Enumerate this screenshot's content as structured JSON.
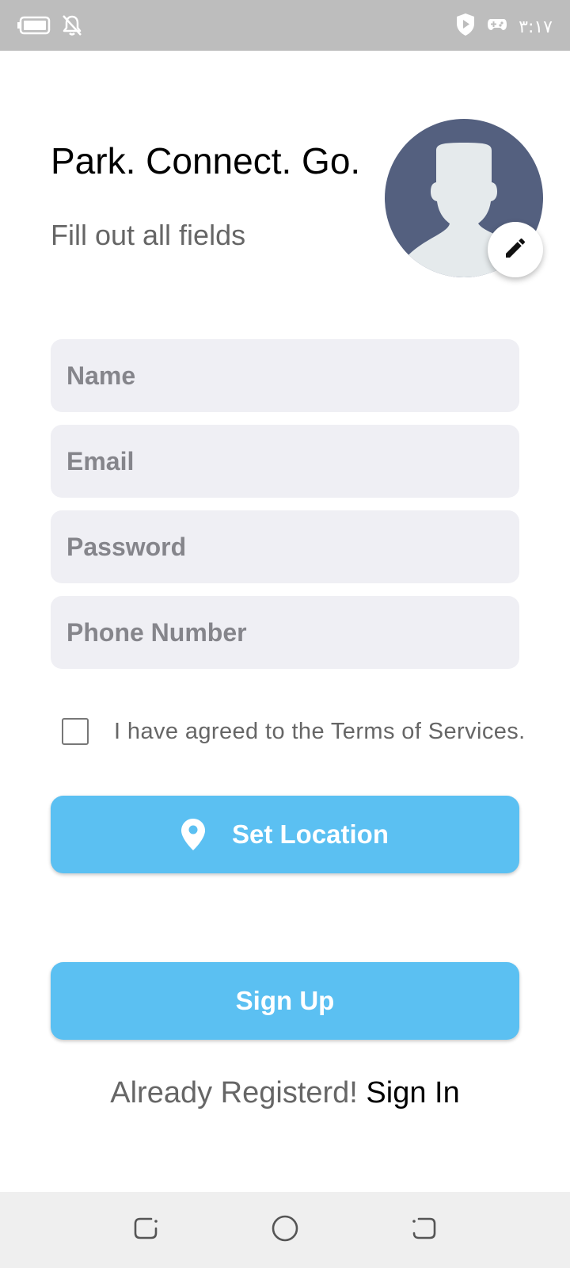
{
  "status_bar": {
    "time": "۳:۱۷",
    "icons": [
      "battery-icon",
      "notifications-off-icon",
      "shield-play-icon",
      "gamepad-icon"
    ]
  },
  "header": {
    "title": "Park. Connect. Go.",
    "subtitle": "Fill out all fields"
  },
  "avatar": {
    "icon": "person-silhouette-icon",
    "edit_icon": "pencil-icon",
    "colors": {
      "background": "#54607f",
      "figure": "#e5eaec"
    }
  },
  "form": {
    "name_placeholder": "Name",
    "email_placeholder": "Email",
    "password_placeholder": "Password",
    "phone_placeholder": "Phone Number",
    "terms_label": "I have agreed to the Terms of Services.",
    "terms_checked": false
  },
  "buttons": {
    "set_location_label": "Set Location",
    "set_location_icon": "location-pin-icon",
    "sign_up_label": "Sign Up"
  },
  "footer": {
    "prompt": "Already Registerd!",
    "sign_in_label": "Sign In"
  },
  "nav_bar": {
    "icons": [
      "back-icon",
      "home-icon",
      "recents-icon"
    ]
  },
  "colors": {
    "accent": "#5bc0f2",
    "field_background": "#efeff4",
    "status_bar": "#bdbdbd",
    "nav_bar": "#efefef"
  }
}
